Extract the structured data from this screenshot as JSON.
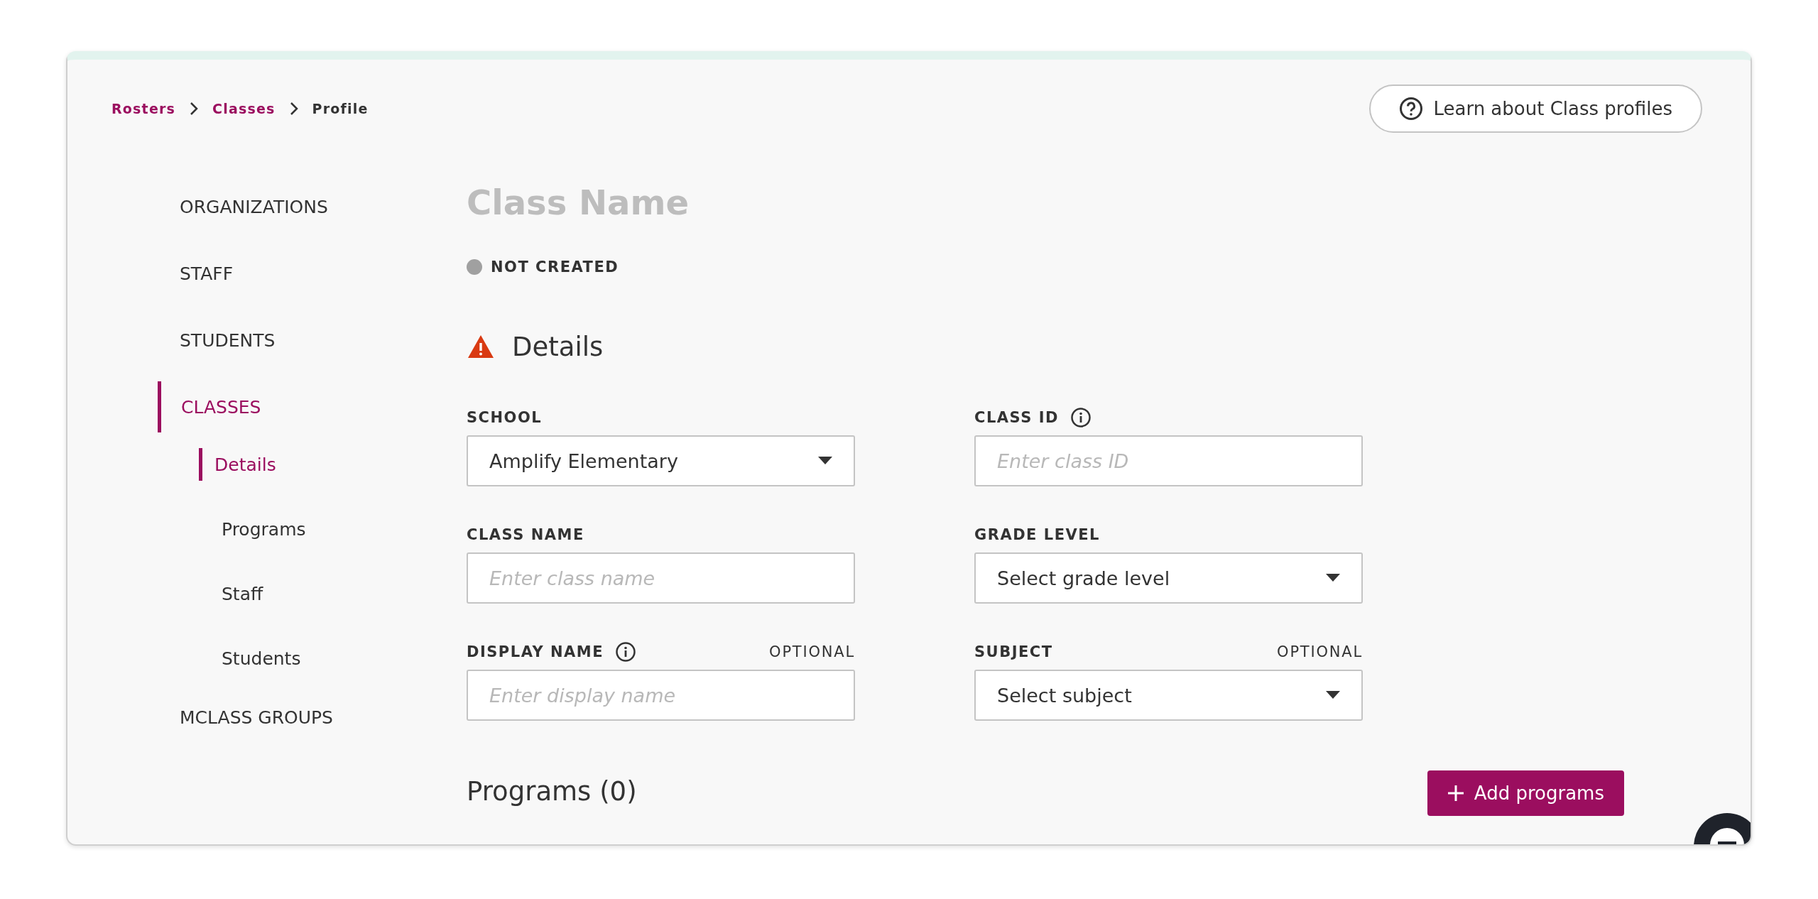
{
  "breadcrumbs": [
    {
      "label": "Rosters",
      "kind": "link"
    },
    {
      "label": "Classes",
      "kind": "link"
    },
    {
      "label": "Profile",
      "kind": "current"
    }
  ],
  "help_button": {
    "label": "Learn about Class profiles"
  },
  "sidebar": {
    "items": [
      {
        "label": "ORGANIZATIONS",
        "selected": false
      },
      {
        "label": "STAFF",
        "selected": false
      },
      {
        "label": "STUDENTS",
        "selected": false
      },
      {
        "label": "CLASSES",
        "selected": true,
        "children": [
          {
            "label": "Details",
            "selected": true
          },
          {
            "label": "Programs",
            "selected": false
          },
          {
            "label": "Staff",
            "selected": false
          },
          {
            "label": "Students",
            "selected": false
          }
        ]
      },
      {
        "label": "MCLASS GROUPS",
        "selected": false
      }
    ]
  },
  "title": "Class Name",
  "status": {
    "label": "NOT CREATED",
    "color": "#a0a0a0"
  },
  "details": {
    "title": "Details",
    "warning": true,
    "fields": [
      {
        "kind": "select",
        "label": "SCHOOL",
        "info": false,
        "value": "Amplify Elementary"
      },
      {
        "kind": "text",
        "label": "CLASS ID",
        "info": true,
        "placeholder": "Enter class ID"
      },
      {
        "kind": "text",
        "label": "CLASS NAME",
        "info": false,
        "placeholder": "Enter class name"
      },
      {
        "kind": "select",
        "label": "GRADE LEVEL",
        "info": false,
        "value": "Select grade level"
      },
      {
        "kind": "text",
        "label": "DISPLAY NAME",
        "info": true,
        "optional": "OPTIONAL",
        "placeholder": "Enter display name"
      },
      {
        "kind": "select",
        "label": "SUBJECT",
        "info": false,
        "optional": "OPTIONAL",
        "value": "Select subject"
      }
    ]
  },
  "programs": {
    "title": "Programs (0)",
    "add_button": "Add programs"
  }
}
